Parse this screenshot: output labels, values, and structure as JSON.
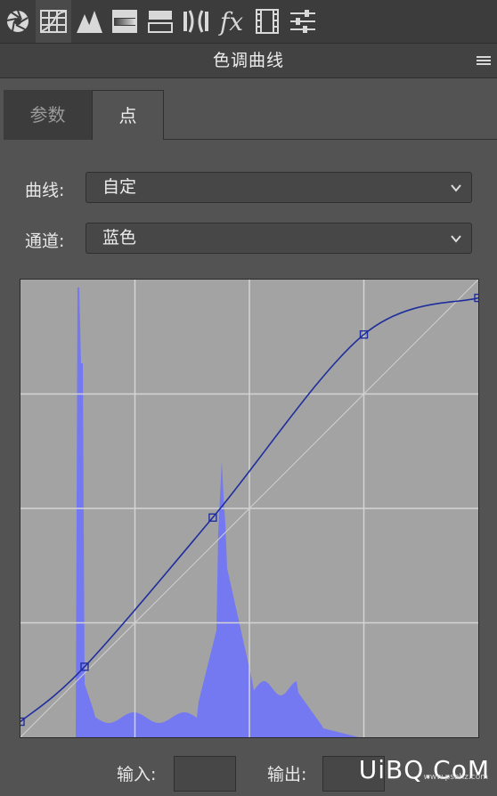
{
  "toolbar": {
    "icons": [
      "aperture-icon",
      "grid-table-icon",
      "triangles-icon",
      "gradient-bar-icon",
      "split-bars-icon",
      "lens-icon",
      "fx-icon",
      "film-strip-icon",
      "sliders-icon"
    ],
    "fx_label": "fx"
  },
  "panel": {
    "title": "色调曲线"
  },
  "tabs": [
    {
      "label": "参数",
      "active": false
    },
    {
      "label": "点",
      "active": true
    }
  ],
  "curve": {
    "label": "曲线:",
    "value": "自定"
  },
  "channel": {
    "label": "通道:",
    "value": "蓝色"
  },
  "histogram_color": "#7479f2",
  "curve_color": "#1f2e9e",
  "input_label": "输入:",
  "output_label": "输出:",
  "input_value": "",
  "output_value": "",
  "watermark": {
    "text": "UiBQ.CoM",
    "sub": "www.psahz.com"
  }
}
